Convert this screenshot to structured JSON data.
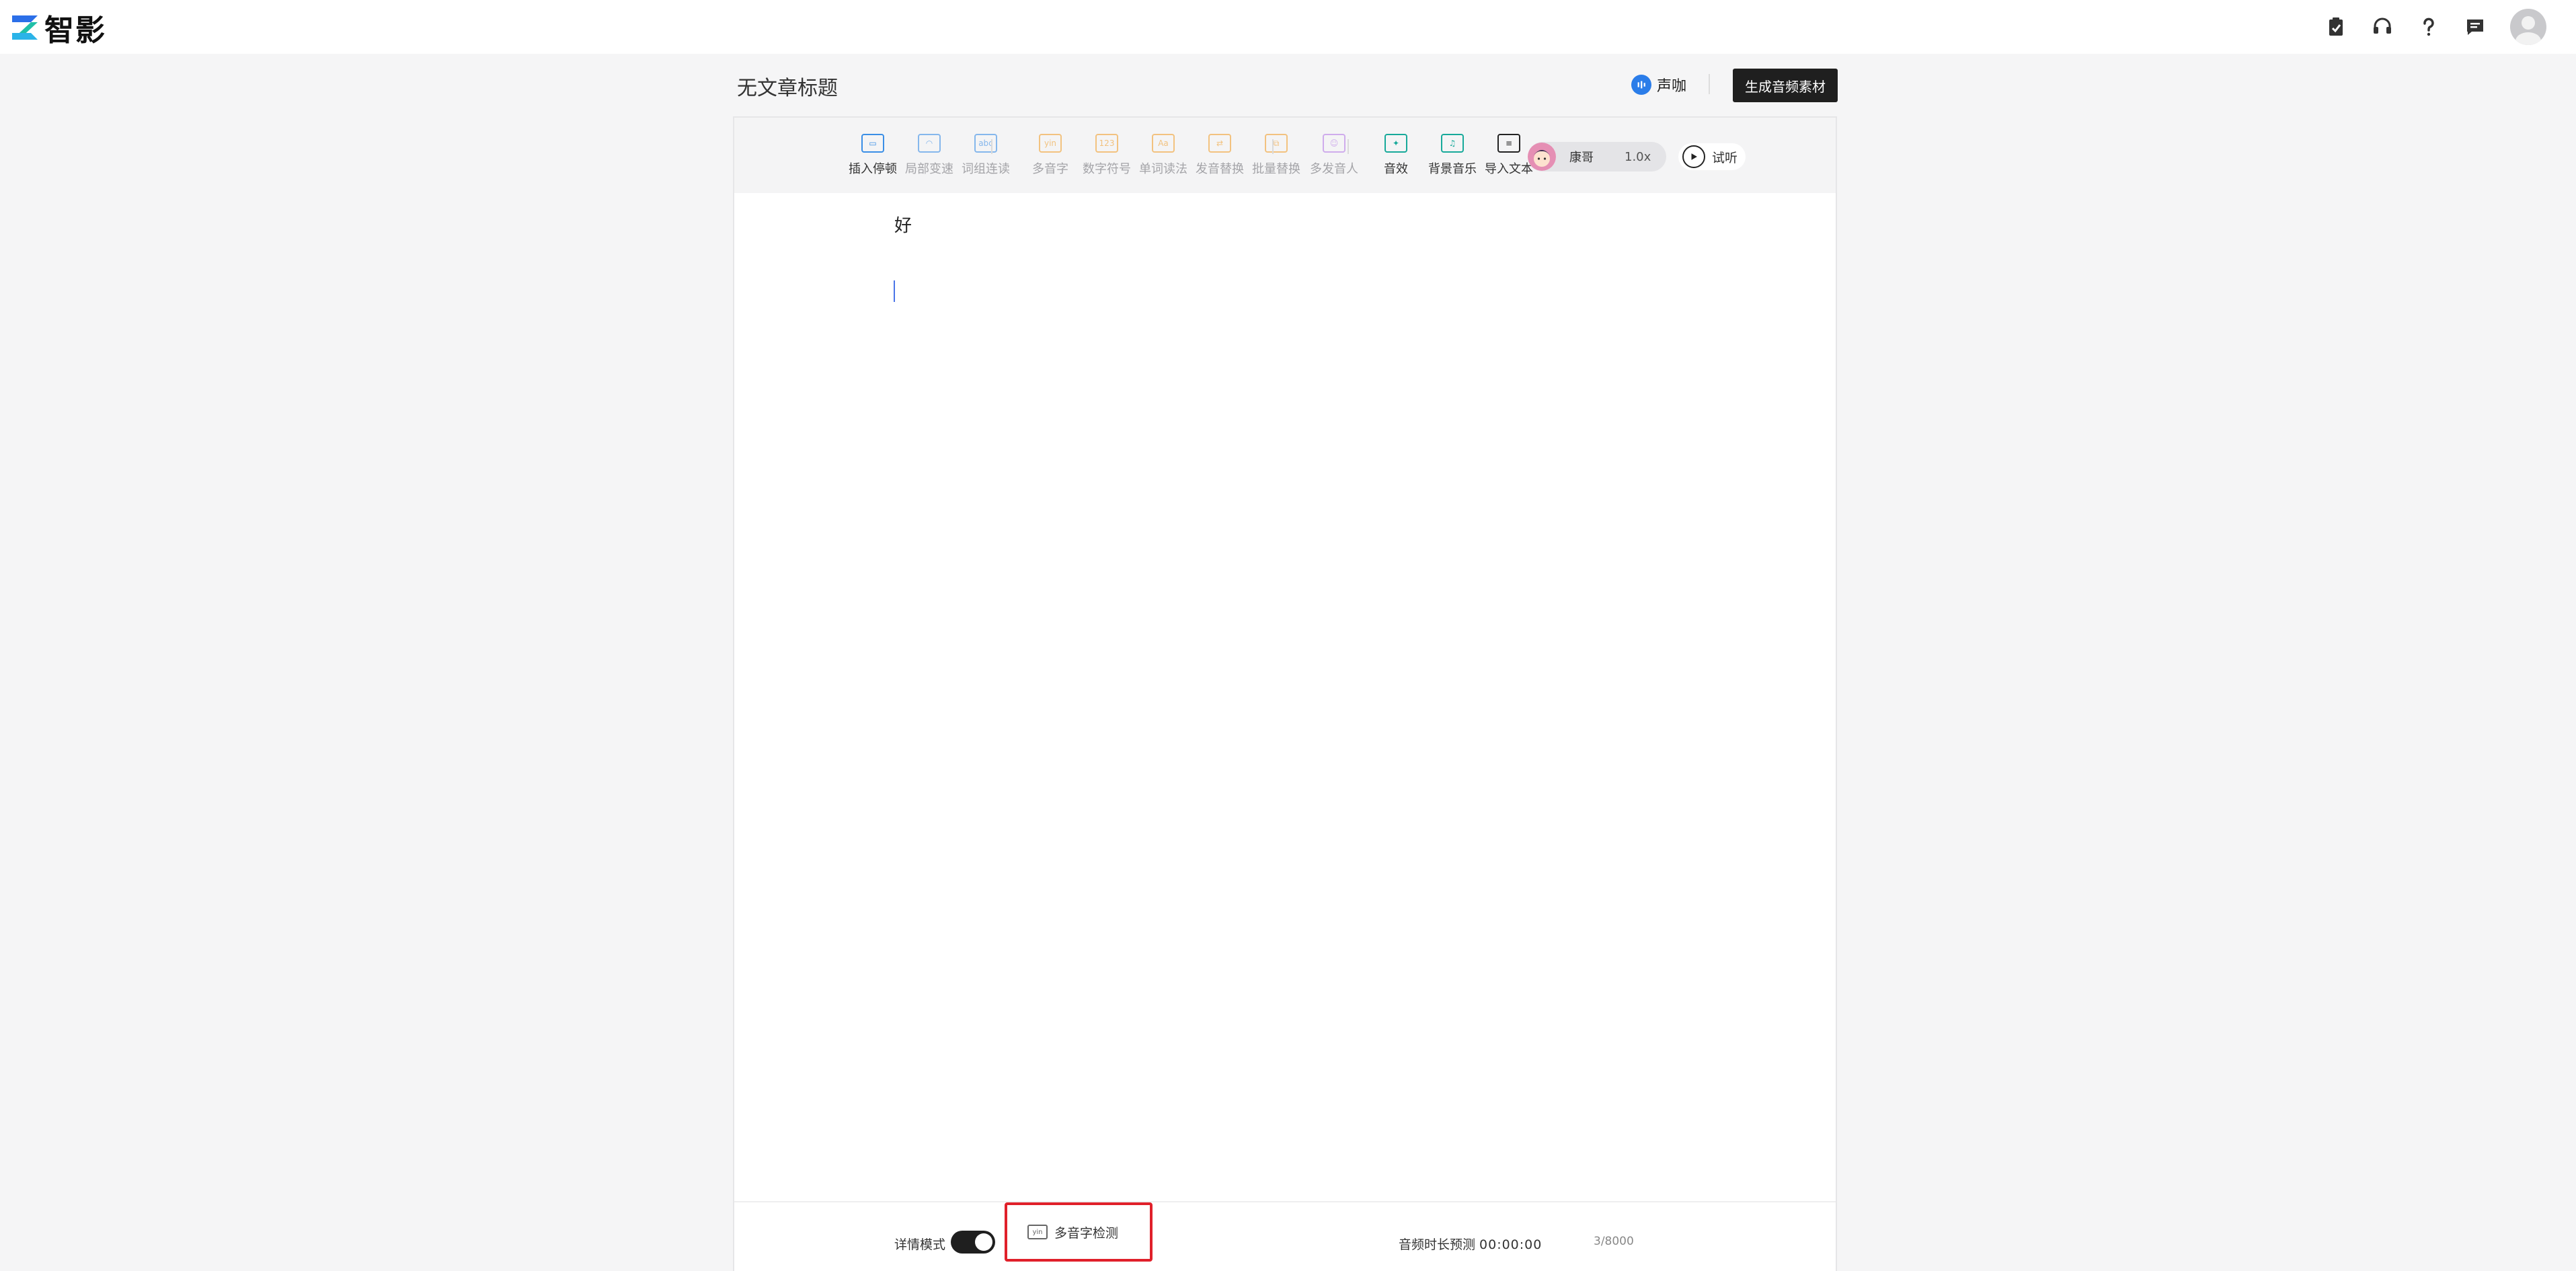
{
  "brand": {
    "name": "智影"
  },
  "header": {
    "doc_title": "无文章标题",
    "voice_card_label": "声咖",
    "generate_button": "生成音频素材"
  },
  "toolbar": {
    "tools": [
      {
        "label": "插入停顿",
        "icon": "pause-insert-icon",
        "color": "#3a8ee6",
        "glyph": "▭",
        "active": true
      },
      {
        "label": "局部变速",
        "icon": "speed-icon",
        "color": "#3a8ee6",
        "glyph": "◠",
        "active": false
      },
      {
        "label": "词组连读",
        "icon": "phrase-link-icon",
        "color": "#3a8ee6",
        "glyph": "abc",
        "active": false
      },
      {
        "label": "多音字",
        "icon": "polyphone-icon",
        "color": "#f0a030",
        "glyph": "yin",
        "active": false
      },
      {
        "label": "数字符号",
        "icon": "number-symbol-icon",
        "color": "#f0a030",
        "glyph": "123",
        "active": false
      },
      {
        "label": "单词读法",
        "icon": "word-reading-icon",
        "color": "#f0a030",
        "glyph": "Aa",
        "active": false
      },
      {
        "label": "发音替换",
        "icon": "pronunciation-replace-icon",
        "color": "#f0a030",
        "glyph": "⇄",
        "active": false
      },
      {
        "label": "批量替换",
        "icon": "batch-replace-icon",
        "color": "#f0a030",
        "glyph": "⧉",
        "active": false
      },
      {
        "label": "多发音人",
        "icon": "multi-speaker-icon",
        "color": "#b57ce6",
        "glyph": "☺",
        "active": false
      },
      {
        "label": "音效",
        "icon": "sound-effect-icon",
        "color": "#17a99a",
        "glyph": "✦",
        "active": true
      },
      {
        "label": "背景音乐",
        "icon": "background-music-icon",
        "color": "#17a99a",
        "glyph": "♫",
        "active": true
      },
      {
        "label": "导入文本",
        "icon": "import-text-icon",
        "color": "#222222",
        "glyph": "≡",
        "active": true
      }
    ],
    "voice_name": "康哥",
    "voice_speed": "1.0x",
    "tryout_label": "试听"
  },
  "editor": {
    "text": "好"
  },
  "bottom": {
    "detail_mode_label": "详情模式",
    "detail_mode_on": true,
    "polyphone_check_label": "多音字检测",
    "duration_label": "音频时长预测",
    "duration_value": "00:00:00",
    "char_count": "3/8000"
  },
  "colors": {
    "accent_dark": "#1f1f1f",
    "highlight_red": "#e0202a"
  }
}
